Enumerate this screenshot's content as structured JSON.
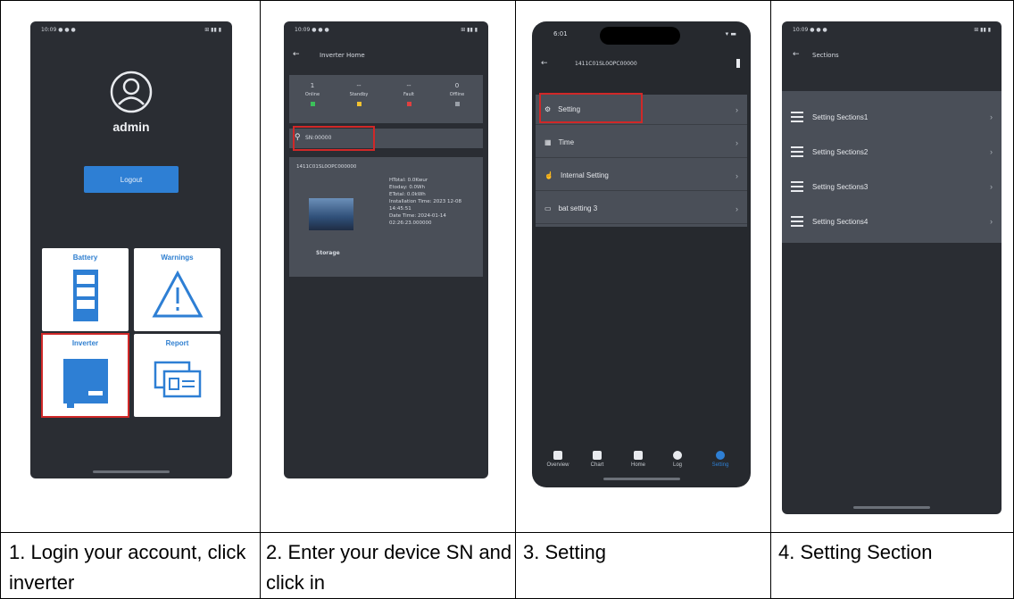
{
  "captions": [
    "1. Login your account, click inverter",
    "2. Enter your device SN and click in",
    "3. Setting",
    "4. Setting Section"
  ],
  "screen1": {
    "username": "admin",
    "logout_label": "Logout",
    "tiles": [
      "Battery",
      "Warnings",
      "Inverter",
      "Report"
    ]
  },
  "screen2": {
    "title": "Inverter Home",
    "stats": [
      {
        "value": "1",
        "label": "Online",
        "color": "#3cc05a"
      },
      {
        "value": "--",
        "label": "Standby",
        "color": "#f2c230"
      },
      {
        "value": "--",
        "label": "Fault",
        "color": "#e04040"
      },
      {
        "value": "0",
        "label": "Offline",
        "color": "#9aa0a8"
      }
    ],
    "search_value": "SN:00000",
    "device": {
      "sn": "1411C01SL0OPC000000",
      "details": [
        "HTotal: 0.0Kwur",
        "Etoday: 0.0Wh",
        "ETotal: 0.0kWh",
        "Installation Time: 2023 12-08 14:45:51",
        "Date Time: 2024-01-14 02:26:23.000000"
      ],
      "type": "Storage"
    }
  },
  "screen3": {
    "time": "6:01",
    "title": "1411C01SL0OPC00000",
    "items": [
      "Setting",
      "Time",
      "Internal Setting",
      "bat setting 3"
    ],
    "nav": [
      "Overview",
      "Chart",
      "Home",
      "Log",
      "Setting"
    ]
  },
  "screen4": {
    "title": "Sections",
    "items": [
      "Setting Sections1",
      "Setting Sections2",
      "Setting Sections3",
      "Setting Sections4"
    ]
  }
}
